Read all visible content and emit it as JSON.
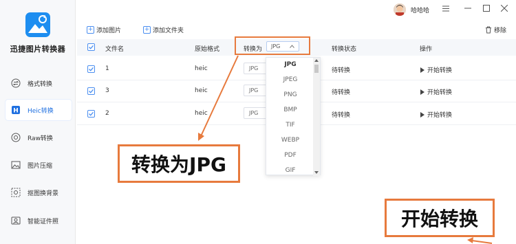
{
  "app": {
    "title": "迅捷图片转换器",
    "username": "哈哈哈",
    "accent_color": "#1e8ef0",
    "annotation_color": "#e77a3d"
  },
  "window_controls": {
    "menu_icon": "menu-icon",
    "minimize_icon": "minimize-icon",
    "maximize_icon": "maximize-icon",
    "close_icon": "close-icon"
  },
  "sidebar": {
    "items": [
      {
        "label": "格式转换",
        "icon": "swap-icon",
        "active": false
      },
      {
        "label": "Heic转换",
        "icon": "heic-icon",
        "active": true
      },
      {
        "label": "Raw转换",
        "icon": "raw-icon",
        "active": false
      },
      {
        "label": "图片压缩",
        "icon": "image-compress-icon",
        "active": false
      },
      {
        "label": "抠图换背景",
        "icon": "cutout-icon",
        "active": false
      },
      {
        "label": "智能证件照",
        "icon": "id-photo-icon",
        "active": false
      }
    ]
  },
  "toolbar": {
    "add_image": "添加图片",
    "add_folder": "添加文件夹",
    "remove": "移除"
  },
  "table": {
    "headers": {
      "filename": "文件名",
      "original_format": "原始格式",
      "convert_to": "转换为",
      "convert_status": "转换状态",
      "action": "操作"
    },
    "convert_to_value": "JPG",
    "rows": [
      {
        "filename": "1",
        "format": "heic",
        "target": "JPG",
        "status": "待转换",
        "action": "开始转换"
      },
      {
        "filename": "3",
        "format": "heic",
        "target": "JPG",
        "status": "待转换",
        "action": "开始转换"
      },
      {
        "filename": "2",
        "format": "heic",
        "target": "JPG",
        "status": "待转换",
        "action": "开始转换"
      }
    ]
  },
  "dropdown": {
    "options": [
      "JPG",
      "JPEG",
      "PNG",
      "BMP",
      "TIF",
      "WEBP",
      "PDF",
      "GIF"
    ],
    "selected": "JPG"
  },
  "annotations": {
    "callout_convert": "转换为JPG",
    "callout_start": "开始转换"
  }
}
